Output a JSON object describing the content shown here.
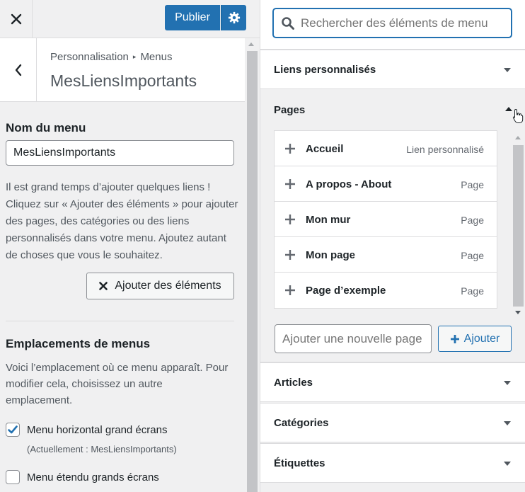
{
  "topbar": {
    "publish_label": "Publier"
  },
  "header": {
    "breadcrumb_root": "Personnalisation",
    "breadcrumb_current": "Menus",
    "title": "MesLiensImportants"
  },
  "menu_name": {
    "label": "Nom du menu",
    "value": "MesLiensImportants"
  },
  "help_text": "Il est grand temps d’ajouter quelques liens ! Cliquez sur « Ajouter des éléments » pour ajouter des pages, des catégories ou des liens personnalisés dans votre menu. Ajoutez autant de choses que vous le souhaitez.",
  "add_items_label": "Ajouter des éléments",
  "locations": {
    "title": "Emplacements de menus",
    "description": "Voici l’emplacement où ce menu apparaît. Pour modifier cela, choisissez un autre emplacement.",
    "items": [
      {
        "label": "Menu horizontal grand écrans",
        "note": "(Actuellement : MesLiensImportants)",
        "checked": true
      },
      {
        "label": "Menu étendu grands écrans",
        "checked": false
      }
    ]
  },
  "search": {
    "placeholder": "Rechercher des éléments de menu"
  },
  "accordions": {
    "custom_links": "Liens personnalisés",
    "pages": "Pages",
    "articles": "Articles",
    "categories": "Catégories",
    "tags": "Étiquettes"
  },
  "pages": [
    {
      "name": "Accueil",
      "type": "Lien personnalisé"
    },
    {
      "name": "A propos - About",
      "type": "Page"
    },
    {
      "name": "Mon mur",
      "type": "Page"
    },
    {
      "name": "Mon page",
      "type": "Page"
    },
    {
      "name": "Page d’exemple",
      "type": "Page"
    }
  ],
  "new_page": {
    "placeholder": "Ajouter une nouvelle page",
    "button_label": "Ajouter"
  },
  "colors": {
    "accent": "#2271b1",
    "panel_bg": "#f0f0f1",
    "border": "#dcdcde"
  }
}
